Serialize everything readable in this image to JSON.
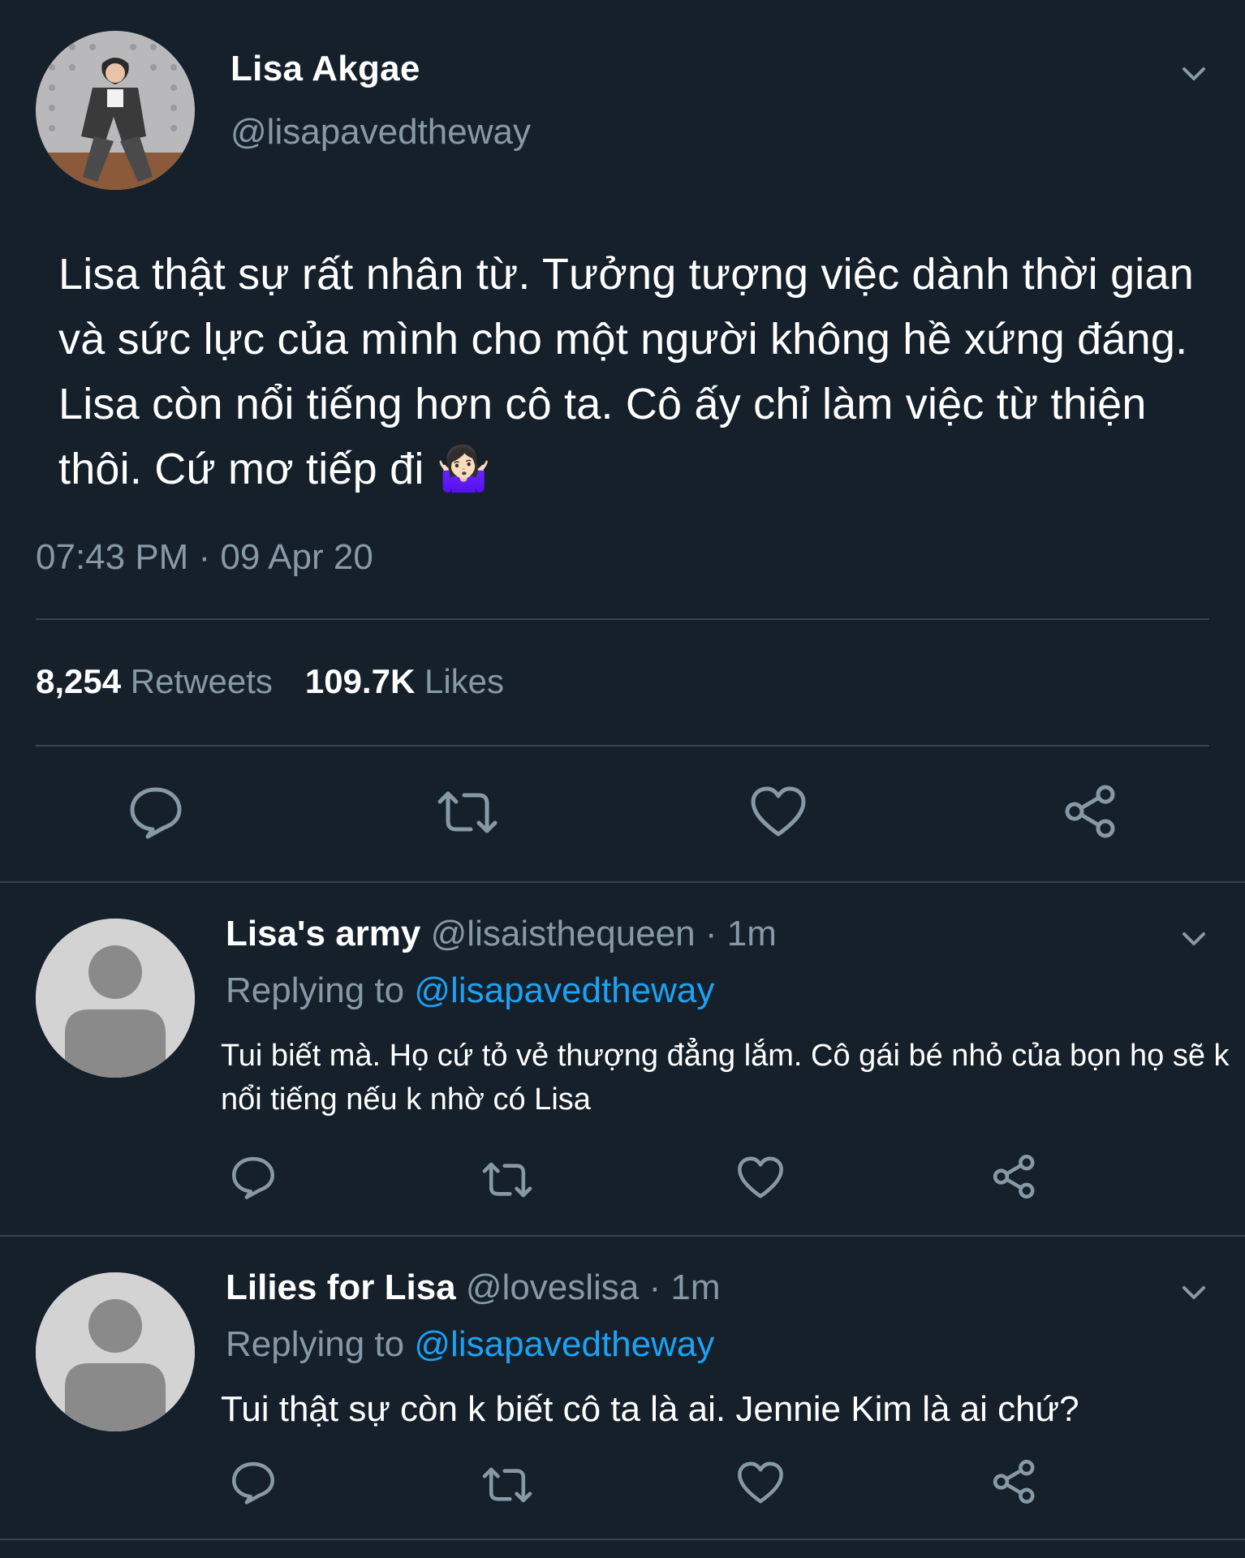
{
  "main_tweet": {
    "display_name": "Lisa Akgae",
    "handle": "@lisapavedtheway",
    "text": "Lisa thật sự rất nhân từ. Tưởng tượng việc dành thời gian và sức lực của mình cho một người không hề xứng đáng. Lisa còn nổi tiếng hơn cô ta. Cô ấy chỉ làm việc từ thiện thôi. Cứ mơ tiếp đi",
    "emoji": "🤷🏻‍♀️",
    "timestamp": "07:43 PM · 09 Apr 20",
    "retweets_count": "8,254",
    "retweets_label": "Retweets",
    "likes_count": "109.7K",
    "likes_label": "Likes"
  },
  "replies": [
    {
      "display_name": "Lisa's army",
      "handle": "@lisaisthequeen",
      "time": "· 1m",
      "replying_prefix": "Replying to",
      "replying_handle": "@lisapavedtheway",
      "text": "Tui biết mà. Họ cứ tỏ vẻ thượng đẳng lắm. Cô gái bé nhỏ của bọn họ sẽ k nổi tiếng nếu k nhờ có Lisa"
    },
    {
      "display_name": "Lilies for Lisa",
      "handle": "@loveslisa",
      "time": "· 1m",
      "replying_prefix": "Replying to",
      "replying_handle": "@lisapavedtheway",
      "text": "Tui thật sự còn k biết cô ta là ai. Jennie Kim là ai chứ?"
    }
  ],
  "icons": {
    "reply": "reply-icon",
    "retweet": "retweet-icon",
    "like": "heart-icon",
    "share": "share-icon",
    "more": "chevron-down-icon"
  },
  "colors": {
    "background": "#15202b",
    "muted_text": "#8899a6",
    "link": "#1da1f2",
    "divider": "#38444d"
  }
}
